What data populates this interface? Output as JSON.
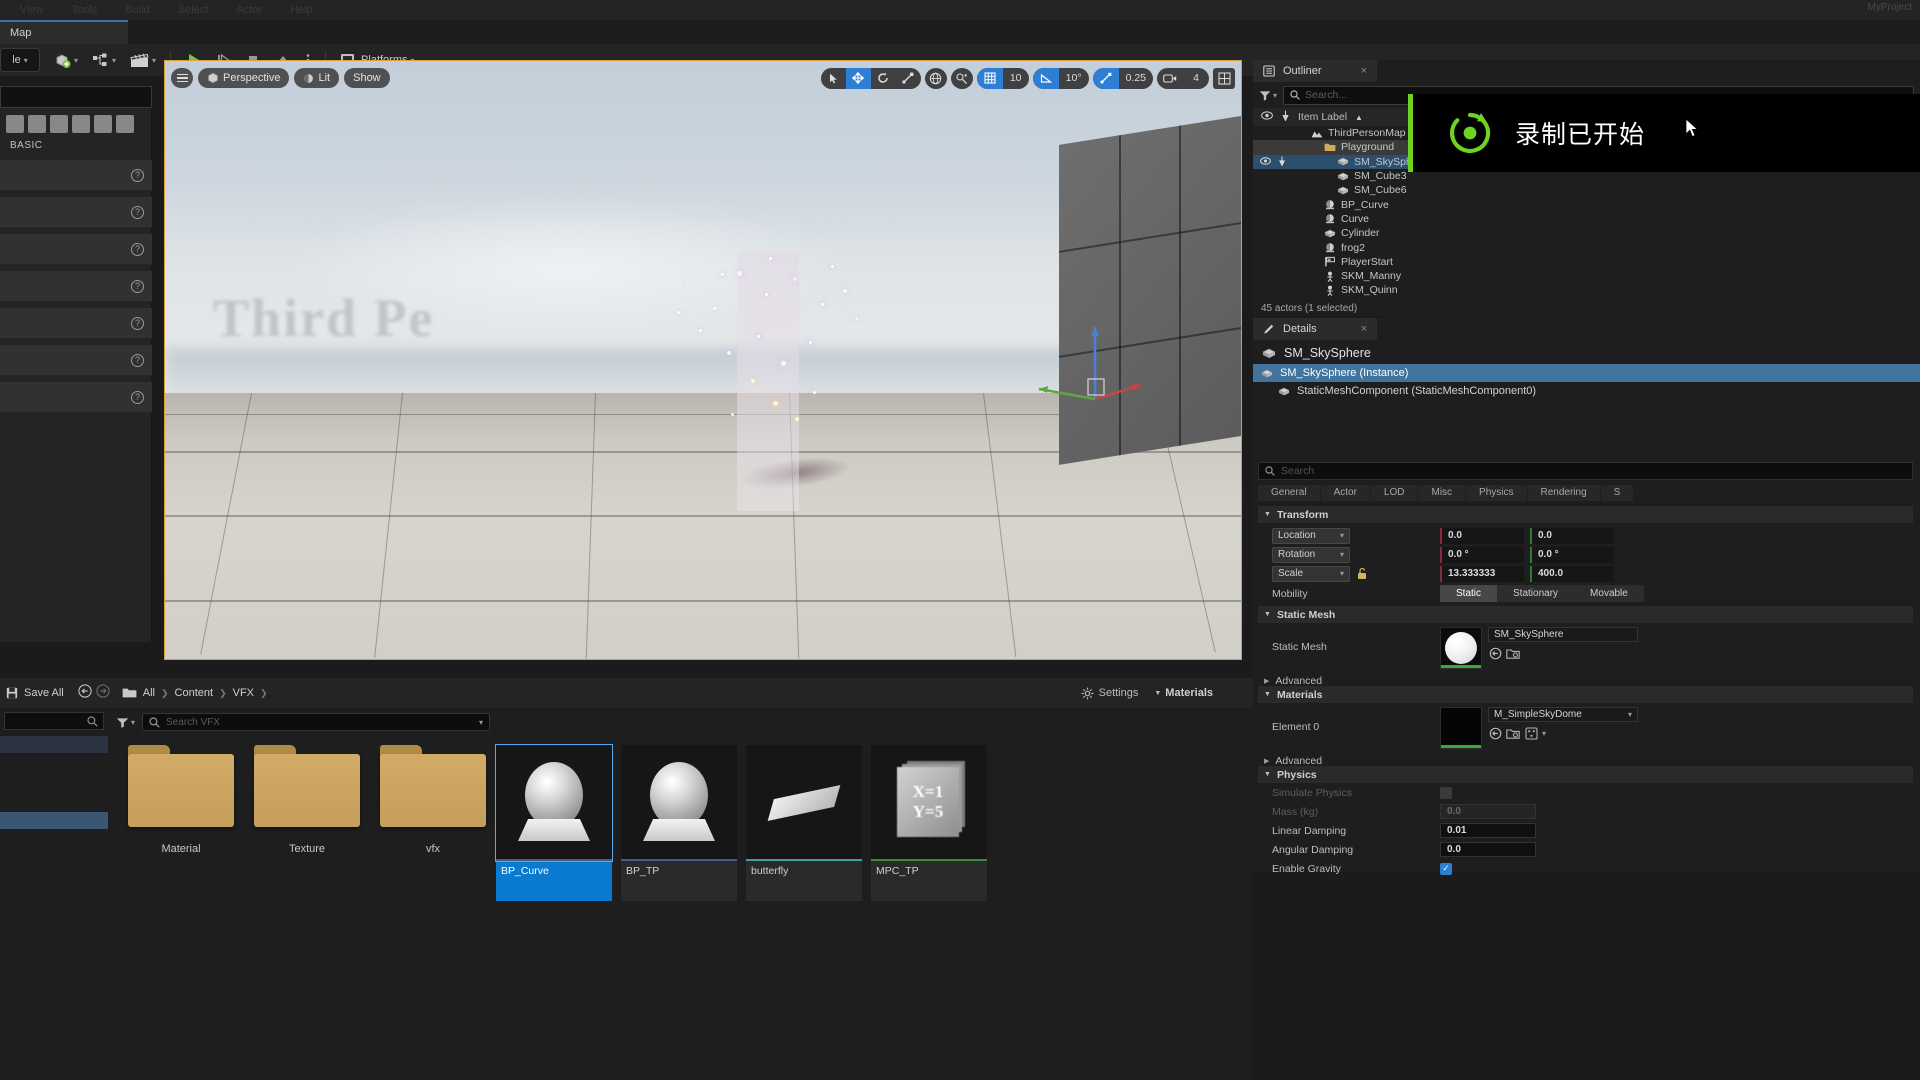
{
  "app": {
    "menu_items": [
      "View",
      "Tools",
      "Build",
      "Select",
      "Actor",
      "Help"
    ],
    "project_label": "MyProject",
    "map_tab": "Map"
  },
  "toolbar": {
    "save_label": "le",
    "create_label": "",
    "blueprints_label": "",
    "cinematics_label": "",
    "play_label": "",
    "platforms_label": "Platforms"
  },
  "place_panel": {
    "category": "BASIC",
    "help_rows": 7
  },
  "viewport": {
    "perspective_label": "Perspective",
    "lit_label": "Lit",
    "show_label": "Show",
    "watermark": "Third Pe",
    "grid_snap_value": "10",
    "angle_snap_value": "10°",
    "scale_snap_value": "0.25",
    "camera_speed_value": "4"
  },
  "outliner": {
    "tab_label": "Outliner",
    "close_label": "×",
    "search_placeholder": "Search...",
    "column_header": "Item Label",
    "sort_arrow": "▲",
    "items": [
      {
        "label": "ThirdPersonMap (Edito",
        "icon": "level-icon",
        "indent": 1,
        "state": "normal",
        "eye": false
      },
      {
        "label": "Playground",
        "icon": "folder-icon",
        "indent": 2,
        "state": "highlight",
        "eye": false
      },
      {
        "label": "SM_SkySphere",
        "icon": "mesh-icon",
        "indent": 3,
        "state": "selected",
        "eye": true
      },
      {
        "label": "SM_Cube3",
        "icon": "mesh-icon",
        "indent": 3,
        "state": "normal",
        "eye": false
      },
      {
        "label": "SM_Cube6",
        "icon": "mesh-icon",
        "indent": 3,
        "state": "normal",
        "eye": false
      },
      {
        "label": "BP_Curve",
        "icon": "blueprint-icon",
        "indent": 2,
        "state": "normal",
        "eye": false
      },
      {
        "label": "Curve",
        "icon": "blueprint-icon",
        "indent": 2,
        "state": "normal",
        "eye": false
      },
      {
        "label": "Cylinder",
        "icon": "mesh-icon",
        "indent": 2,
        "state": "normal",
        "eye": false
      },
      {
        "label": "frog2",
        "icon": "blueprint-icon",
        "indent": 2,
        "state": "normal",
        "eye": false
      },
      {
        "label": "PlayerStart",
        "icon": "playerstart-icon",
        "indent": 2,
        "state": "normal",
        "eye": false
      },
      {
        "label": "SKM_Manny",
        "icon": "skeletal-icon",
        "indent": 2,
        "state": "normal",
        "eye": false
      },
      {
        "label": "SKM_Quinn",
        "icon": "skeletal-icon",
        "indent": 2,
        "state": "normal",
        "eye": false
      }
    ],
    "status": "45 actors (1 selected)"
  },
  "recording_overlay": {
    "text": "录制已开始",
    "accent_color": "#6fd322"
  },
  "details": {
    "tab_label": "Details",
    "close_label": "×",
    "actor_name": "SM_SkySphere",
    "tree": [
      {
        "label": "SM_SkySphere (Instance)",
        "selected": true,
        "indent": 0
      },
      {
        "label": "StaticMeshComponent (StaticMeshComponent0)",
        "selected": false,
        "indent": 1
      }
    ],
    "search_placeholder": "Search",
    "tabs": [
      "General",
      "Actor",
      "LOD",
      "Misc",
      "Physics",
      "Rendering",
      "S"
    ],
    "sections": {
      "transform": {
        "title": "Transform",
        "rows": [
          {
            "label": "Location",
            "x": "0.0",
            "y": "0.0"
          },
          {
            "label": "Rotation",
            "x": "0.0 °",
            "y": "0.0 °"
          },
          {
            "label": "Scale",
            "x": "13.333333",
            "y": "400.0"
          }
        ],
        "mobility_label": "Mobility",
        "mobility_options": [
          "Static",
          "Stationary",
          "Movable"
        ],
        "mobility_selected": "Static"
      },
      "static_mesh": {
        "title": "Static Mesh",
        "row_label": "Static Mesh",
        "asset": "SM_SkySphere",
        "advanced": "Advanced"
      },
      "materials": {
        "title": "Materials",
        "row_label": "Element 0",
        "asset": "M_SimpleSkyDome",
        "advanced": "Advanced"
      },
      "physics": {
        "title": "Physics",
        "rows": [
          {
            "label": "Simulate Physics",
            "value": "",
            "type": "checkbox",
            "disabled": true
          },
          {
            "label": "Mass (kg)",
            "value": "0.0",
            "type": "text",
            "disabled": true
          },
          {
            "label": "Linear Damping",
            "value": "0.01",
            "type": "text",
            "disabled": false
          },
          {
            "label": "Angular Damping",
            "value": "0.0",
            "type": "text",
            "disabled": false
          },
          {
            "label": "Enable Gravity",
            "value": "✓",
            "type": "checkbox",
            "disabled": false
          }
        ]
      }
    }
  },
  "content_browser": {
    "save_all_label": "Save All",
    "breadcrumb": [
      "All",
      "Content",
      "VFX"
    ],
    "settings_label": "Settings",
    "materials_label": "Materials",
    "search_placeholder": "Search VFX",
    "folders": [
      {
        "label": "Material"
      },
      {
        "label": "Texture"
      },
      {
        "label": "vfx"
      }
    ],
    "assets": [
      {
        "label": "BP_Curve",
        "thumb": "blueprint-sphere",
        "bar_color": "#4a5d8a",
        "selected": true
      },
      {
        "label": "BP_TP",
        "thumb": "blueprint-sphere",
        "bar_color": "#4a5d8a",
        "selected": false
      },
      {
        "label": "butterfly",
        "thumb": "plane-mesh",
        "bar_color": "#3fa0a8",
        "selected": false
      },
      {
        "label": "MPC_TP",
        "thumb": "mpc-icon",
        "bar_color": "#3d8a3d",
        "selected": false
      }
    ]
  }
}
